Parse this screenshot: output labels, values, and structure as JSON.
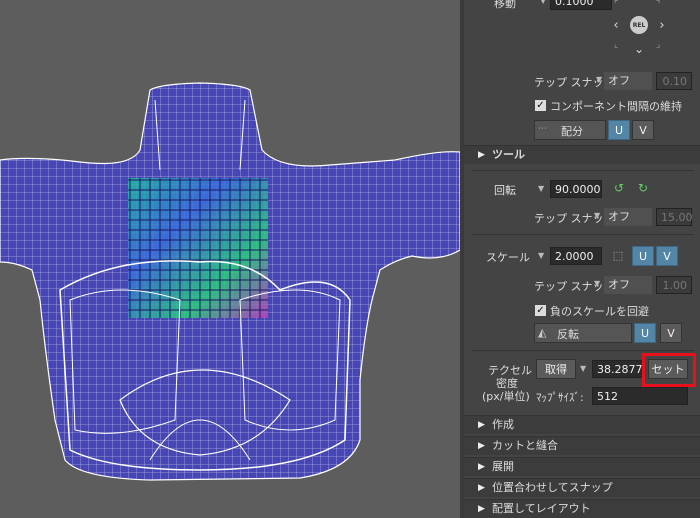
{
  "move": {
    "label": "移動",
    "value": "0.1000"
  },
  "nav_icons": {
    "left": "chevron-left-icon",
    "right": "chevron-right-icon",
    "center": "REL",
    "down": "chevron-down-icon",
    "up": "chevron-up-icon"
  },
  "move_snap": {
    "label": "テップ スナッ",
    "mode": "オフ",
    "value": "0.10"
  },
  "preserve_spacing": {
    "label": "コンポーネント間隔の維持",
    "checked": true
  },
  "distribute": {
    "label": "配分",
    "u": "U",
    "v": "V"
  },
  "tools_section": {
    "label": "ツール"
  },
  "rotate": {
    "label": "回転",
    "value": "90.0000"
  },
  "rotate_snap": {
    "label": "テップ スナッ",
    "mode": "オフ",
    "value": "15.00"
  },
  "scale": {
    "label": "スケール",
    "value": "2.0000",
    "u": "U",
    "v": "V"
  },
  "scale_snap": {
    "label": "テップ スナッ",
    "mode": "オフ",
    "value": "1.00"
  },
  "avoid_negative": {
    "label": "負のスケールを回避",
    "checked": true
  },
  "flip": {
    "label": "反転",
    "u": "U",
    "v": "V"
  },
  "texel_density": {
    "label_line1": "テクセル",
    "label_line2": "密度",
    "label_line3": "(px/単位)",
    "get_button": "取得",
    "value": "38.2877",
    "set_button": "セット",
    "map_size_label": "ﾏｯﾌﾟｻｲｽﾞ:",
    "map_size_value": "512"
  },
  "sections": [
    {
      "label": "作成"
    },
    {
      "label": "カットと縫合"
    },
    {
      "label": "展開"
    },
    {
      "label": "位置合わせしてスナップ"
    },
    {
      "label": "配置してレイアウト"
    }
  ],
  "colors": {
    "accent_blue": "#5285a6",
    "highlight_red": "#e8101a",
    "mesh_fill": "#4a4ab8",
    "wire": "#ffffff"
  }
}
